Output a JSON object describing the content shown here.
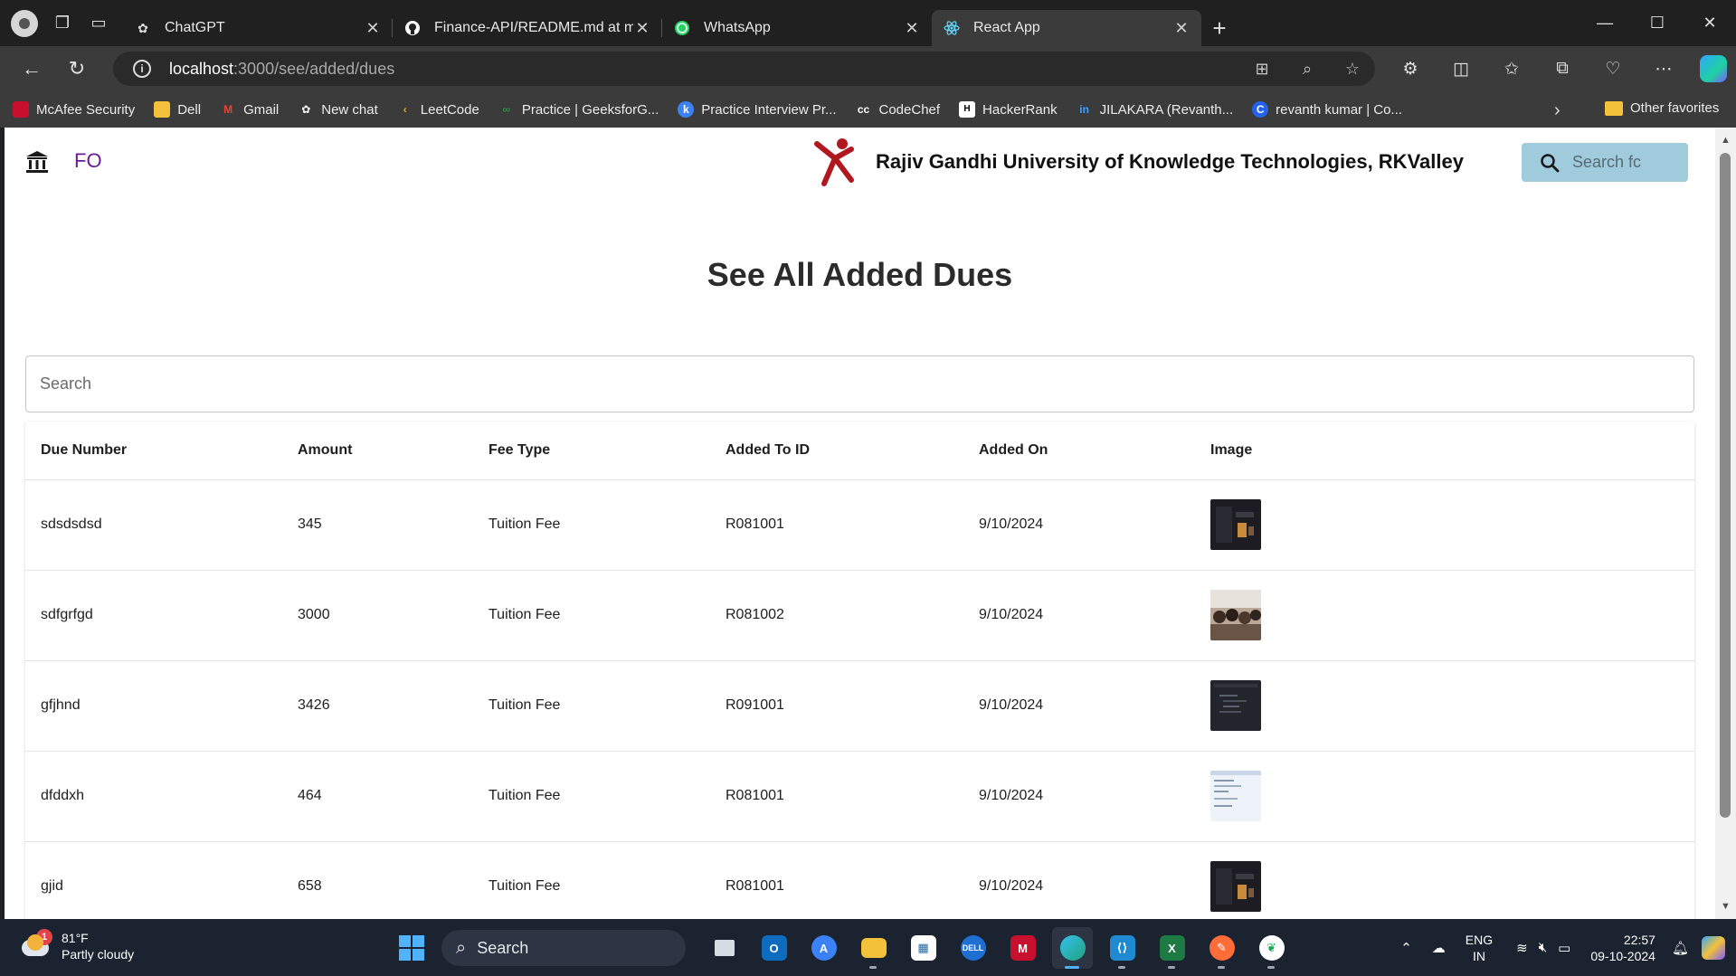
{
  "browser": {
    "tabs": [
      {
        "title": "ChatGPT",
        "icon": "chatgpt-icon",
        "active": false
      },
      {
        "title": "Finance-API/README.md at main",
        "icon": "github-icon",
        "active": false
      },
      {
        "title": "WhatsApp",
        "icon": "whatsapp-icon",
        "active": false
      },
      {
        "title": "React App",
        "icon": "react-icon",
        "active": true
      }
    ],
    "url_host": "localhost",
    "url_path": ":3000/see/added/dues",
    "favorites": [
      {
        "label": "McAfee Security",
        "color": "#c8102e"
      },
      {
        "label": "Dell",
        "color": "#f3c13a"
      },
      {
        "label": "Gmail",
        "color": "#ea4335"
      },
      {
        "label": "New chat",
        "color": "#ffffff"
      },
      {
        "label": "LeetCode",
        "color": "#ffa116"
      },
      {
        "label": "Practice | GeeksforG...",
        "color": "#2f8d46"
      },
      {
        "label": "Practice Interview Pr...",
        "color": "#3b82f6"
      },
      {
        "label": "CodeChef",
        "color": "#ffffff"
      },
      {
        "label": "HackerRank",
        "color": "#ffffff"
      },
      {
        "label": "JILAKARA (Revanth...",
        "color": "#0a66c2"
      },
      {
        "label": "revanth kumar | Co...",
        "color": "#2563eb"
      }
    ],
    "other_favorites": "Other favorites"
  },
  "app": {
    "brand": "FO",
    "university": "Rajiv Gandhi University of Knowledge Technologies, RKValley",
    "top_search_placeholder": "Search fc",
    "page_title": "See All Added Dues",
    "search_placeholder": "Search",
    "columns": [
      "Due Number",
      "Amount",
      "Fee Type",
      "Added To ID",
      "Added On",
      "Image"
    ],
    "rows": [
      {
        "due_number": "sdsdsdsd",
        "amount": "345",
        "fee_type": "Tuition Fee",
        "added_to": "R081001",
        "added_on": "9/10/2024",
        "thumb": "dark-screenshot"
      },
      {
        "due_number": "sdfgrfgd",
        "amount": "3000",
        "fee_type": "Tuition Fee",
        "added_to": "R081002",
        "added_on": "9/10/2024",
        "thumb": "crowd-photo"
      },
      {
        "due_number": "gfjhnd",
        "amount": "3426",
        "fee_type": "Tuition Fee",
        "added_to": "R091001",
        "added_on": "9/10/2024",
        "thumb": "code-screenshot"
      },
      {
        "due_number": "dfddxh",
        "amount": "464",
        "fee_type": "Tuition Fee",
        "added_to": "R081001",
        "added_on": "9/10/2024",
        "thumb": "light-document"
      },
      {
        "due_number": "gjid",
        "amount": "658",
        "fee_type": "Tuition Fee",
        "added_to": "R081001",
        "added_on": "9/10/2024",
        "thumb": "dark-screenshot"
      }
    ],
    "accent": "#6a1b9a"
  },
  "taskbar": {
    "weather_temp": "81°F",
    "weather_desc": "Partly cloudy",
    "weather_badge": "1",
    "search_label": "Search",
    "lang_top": "ENG",
    "lang_bottom": "IN",
    "time": "22:57",
    "date": "09-10-2024"
  }
}
